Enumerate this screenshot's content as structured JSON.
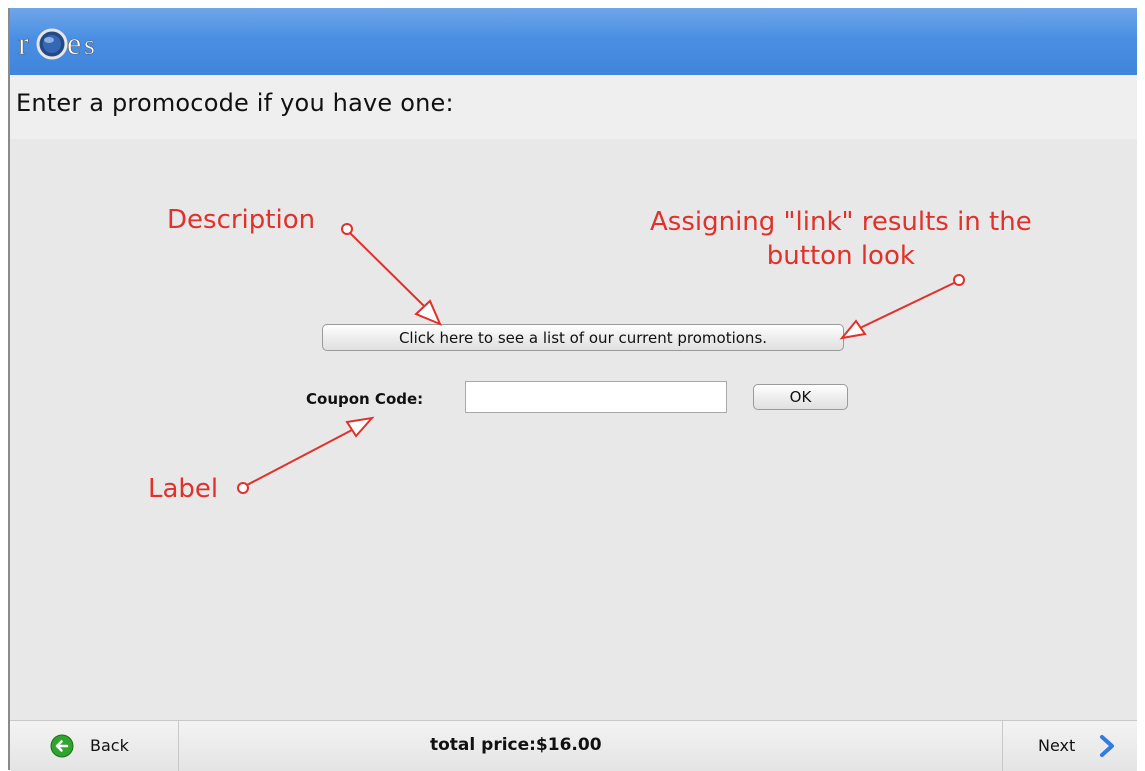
{
  "header": {
    "logo_text": "roes",
    "brand_color": "#4a8fe3"
  },
  "prompt": {
    "text": "Enter a promocode if you have one:"
  },
  "promo": {
    "button_label": "Click here to see a list of our current promotions."
  },
  "coupon": {
    "label": "Coupon Code:",
    "value": "",
    "placeholder": "",
    "ok_label": "OK"
  },
  "annotations": {
    "description": "Description",
    "link_line1": "Assigning \"link\" results in the",
    "link_line2": "button look",
    "label": "Label",
    "color": "#e0312a"
  },
  "footer": {
    "back_label": "Back",
    "back_icon": "back-arrow-circle-icon",
    "total": "total price:$16.00",
    "next_label": "Next",
    "next_icon": "chevron-right-icon"
  }
}
